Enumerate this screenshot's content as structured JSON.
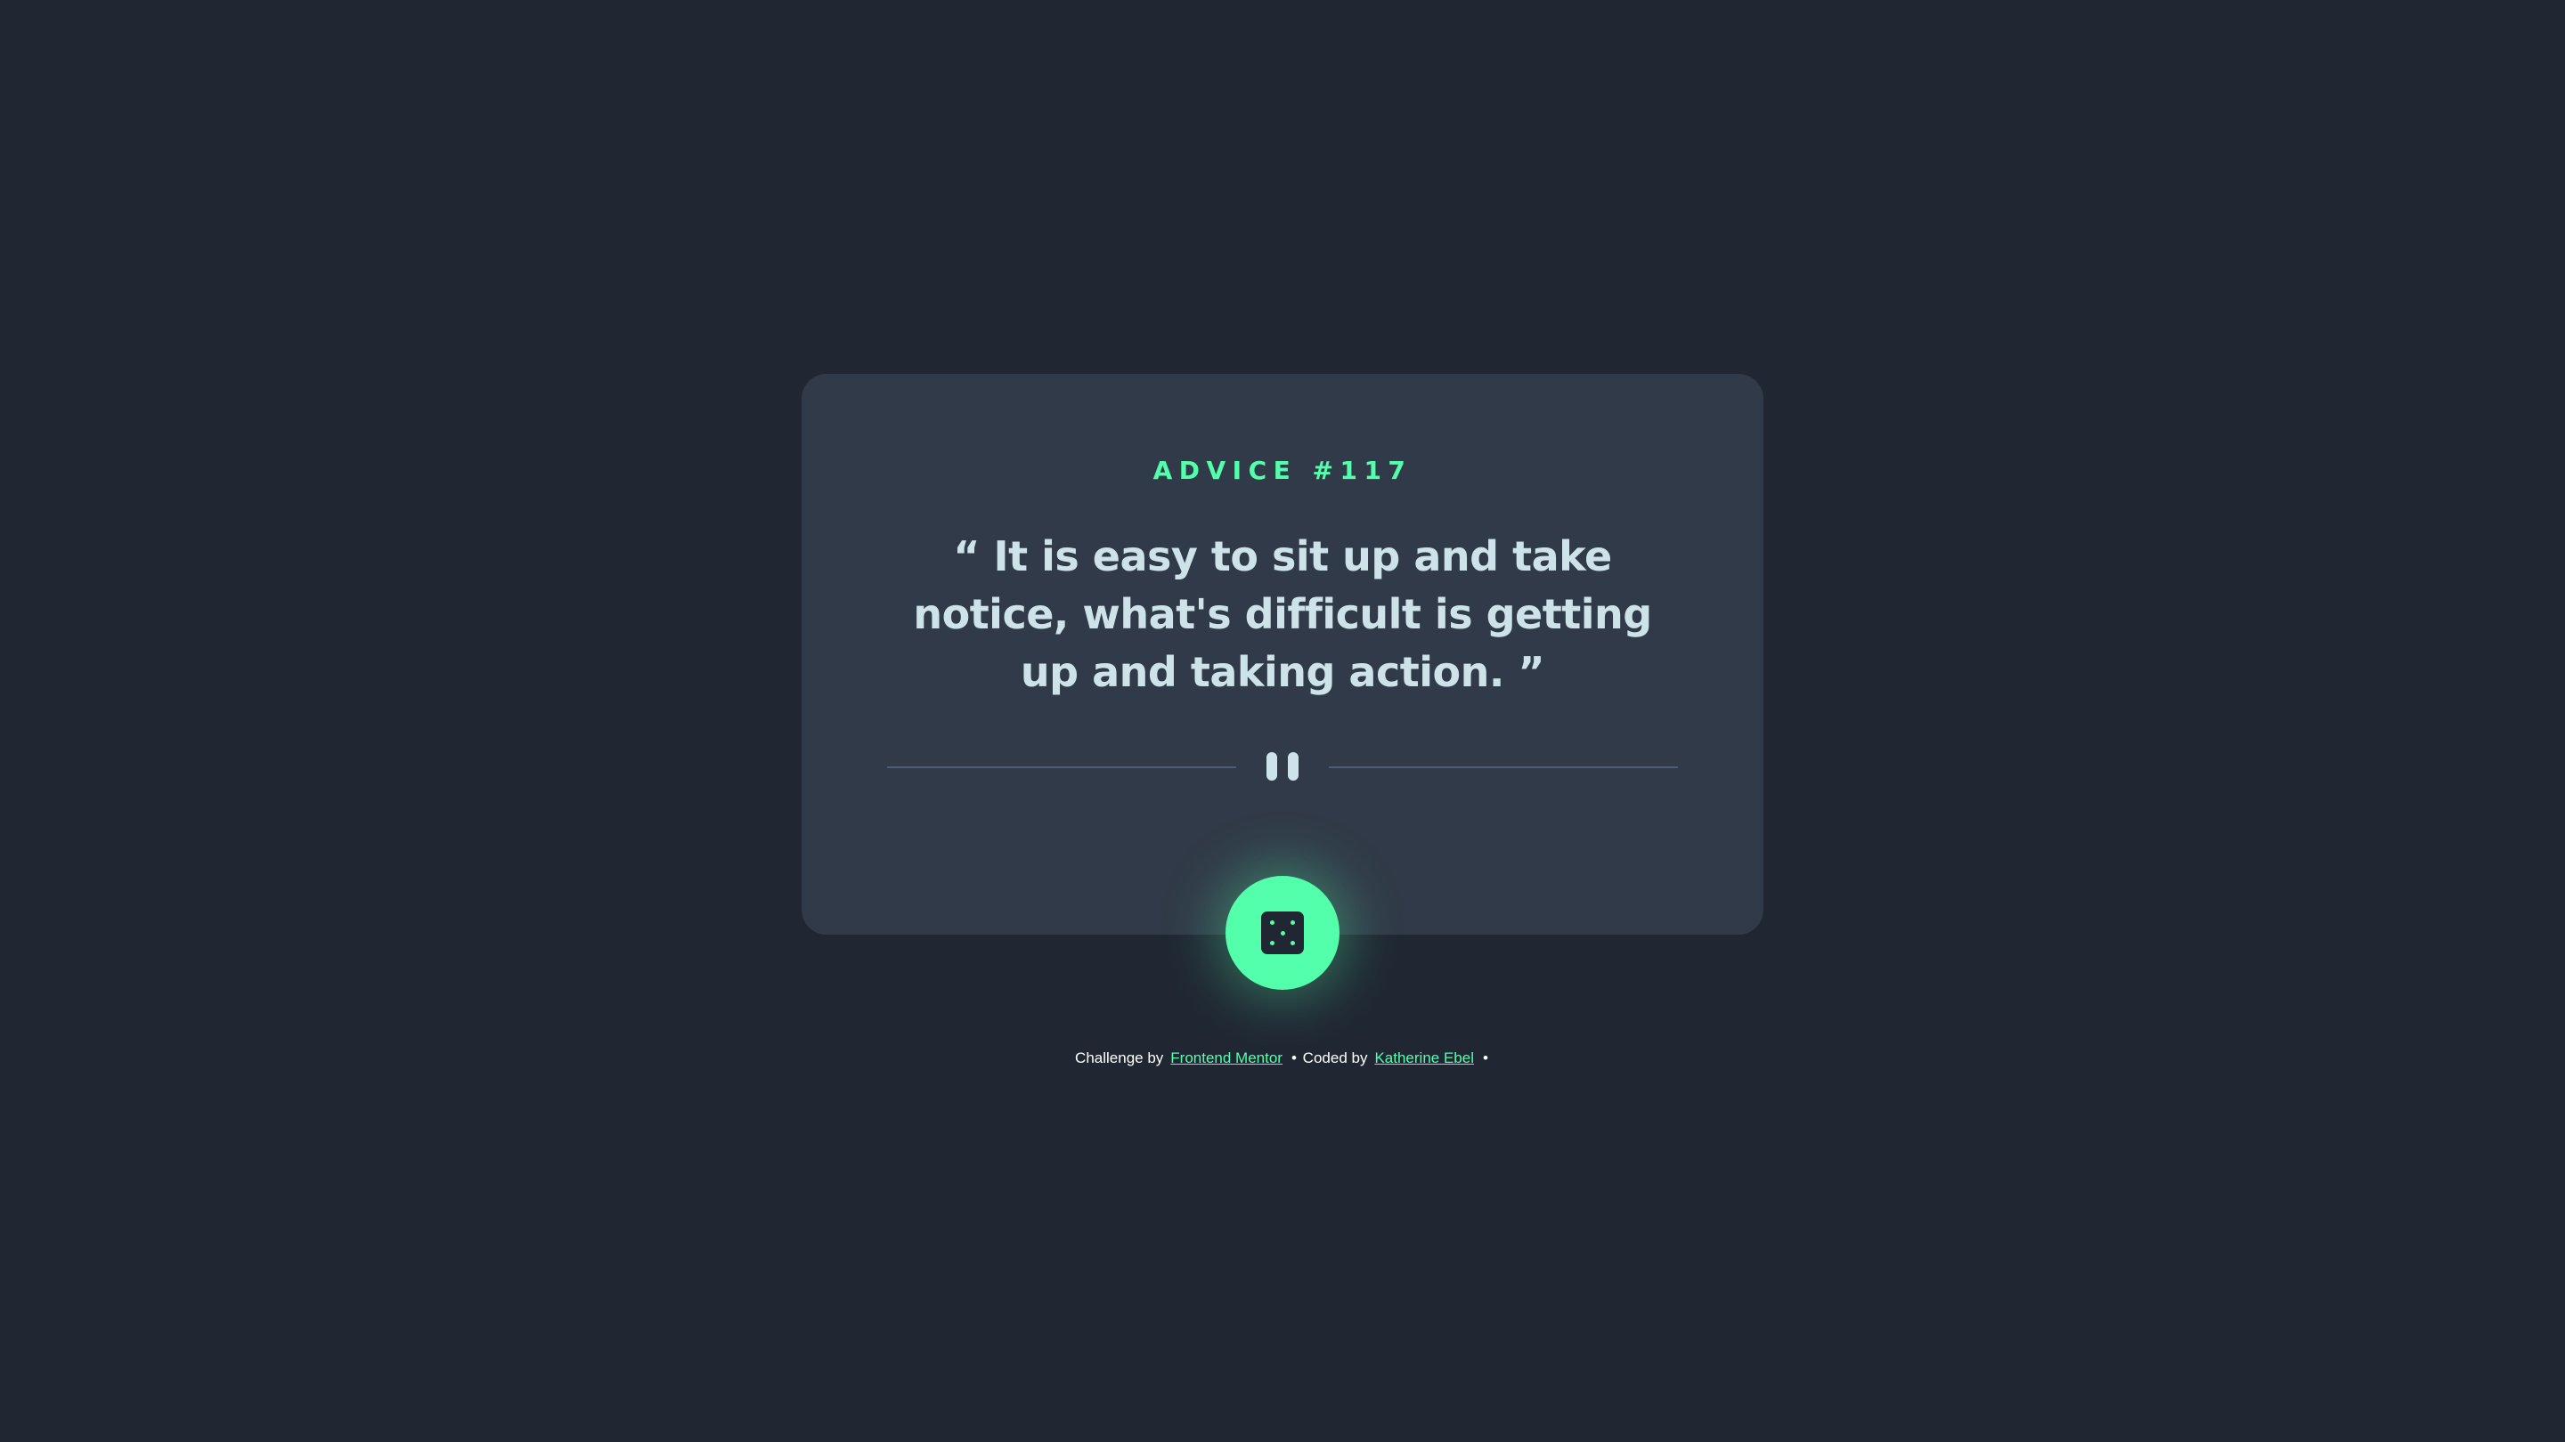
{
  "card": {
    "advice_label": "ADVICE #117",
    "quote": "“ It is easy to sit up and take notice, what's difficult is getting up and taking action. ”",
    "divider_icon": "pause-icon"
  },
  "dice_button": {
    "icon": "dice-icon"
  },
  "attribution": {
    "challenge_prefix": "Challenge by",
    "challenge_link": "Frontend Mentor",
    "separator_1": "•",
    "coded_prefix": "Coded by",
    "coded_link": "Katherine Ebel",
    "separator_2": "•"
  },
  "colors": {
    "background": "#202733",
    "card": "#313a48",
    "accent": "#53ffaa",
    "quote_text": "#cee3e9",
    "divider": "#4f5d74"
  }
}
